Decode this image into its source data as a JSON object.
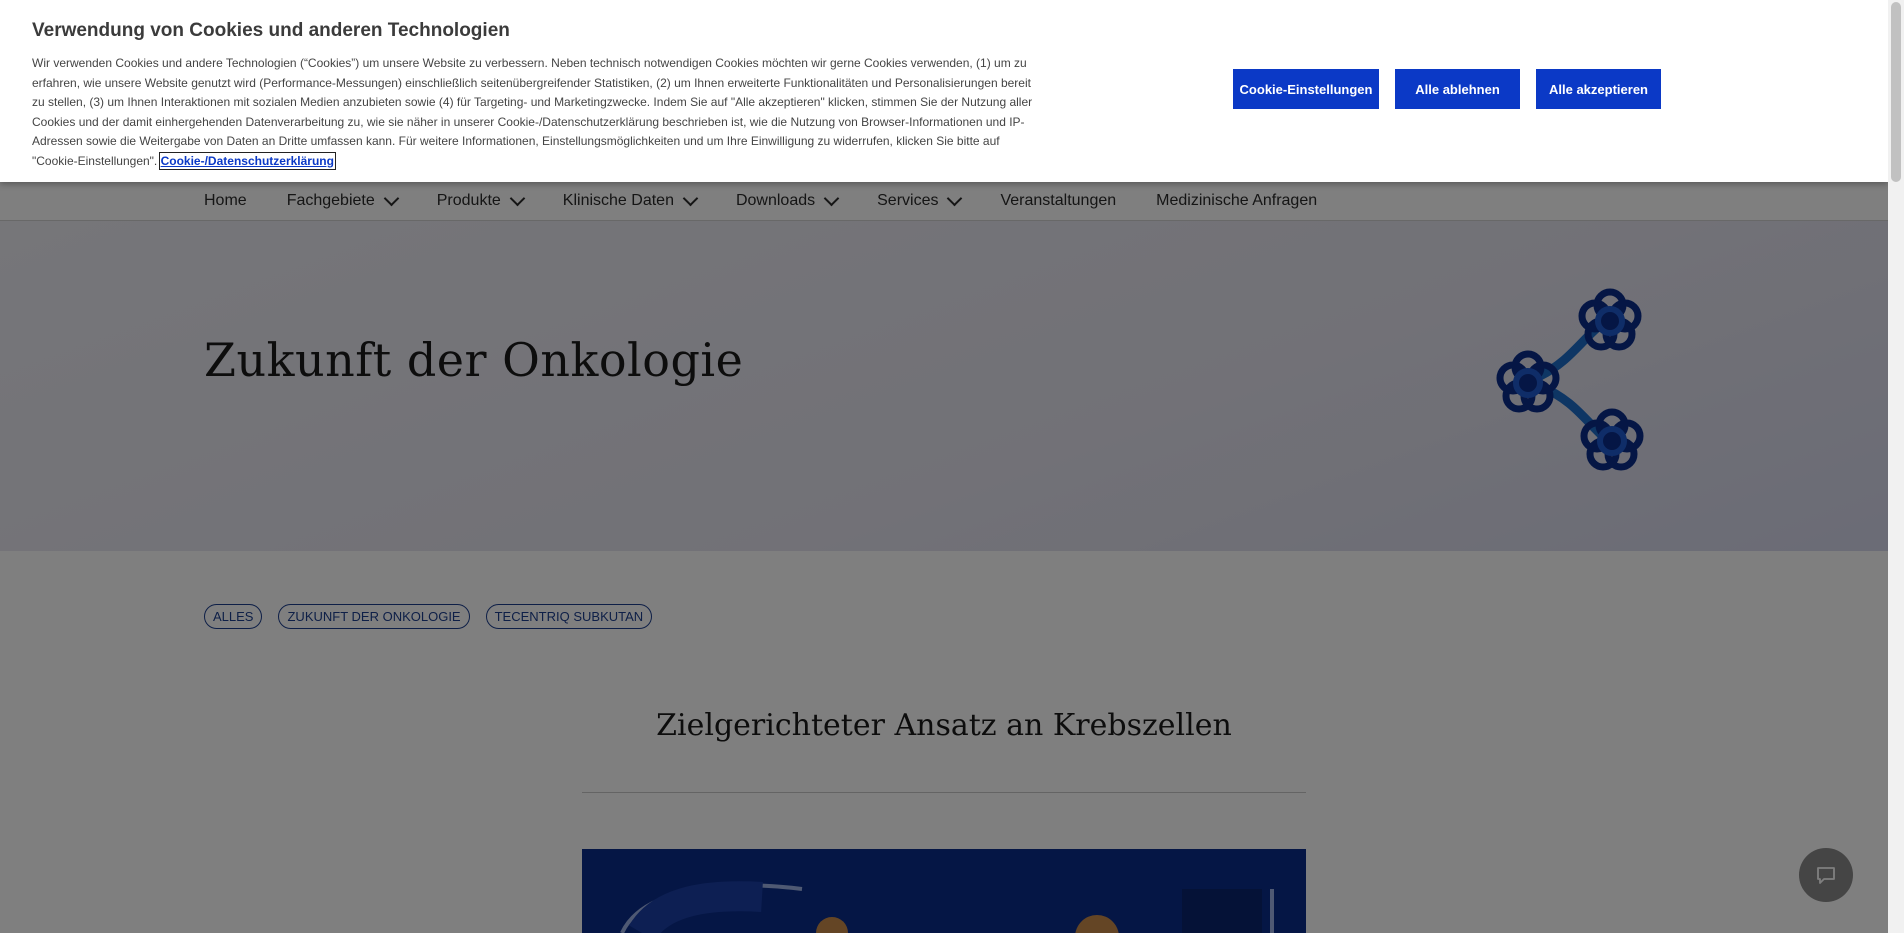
{
  "nav": {
    "items": [
      {
        "label": "Home",
        "has_dropdown": false
      },
      {
        "label": "Fachgebiete",
        "has_dropdown": true
      },
      {
        "label": "Produkte",
        "has_dropdown": true
      },
      {
        "label": "Klinische Daten",
        "has_dropdown": true
      },
      {
        "label": "Downloads",
        "has_dropdown": true
      },
      {
        "label": "Services",
        "has_dropdown": true
      },
      {
        "label": "Veranstaltungen",
        "has_dropdown": false
      },
      {
        "label": "Medizinische Anfragen",
        "has_dropdown": false
      }
    ]
  },
  "hero": {
    "title": "Zukunft der Onkologie",
    "icon": "cell-network-illustration"
  },
  "tags": [
    "ALLES",
    "ZUKUNFT DER ONKOLOGIE",
    "TECENTRIQ SUBKUTAN"
  ],
  "section": {
    "title": "Zielgerichteter Ansatz an Krebszellen"
  },
  "chat": {
    "icon": "chat-icon"
  },
  "cookie_banner": {
    "title": "Verwendung von Cookies und anderen Technologien",
    "text": "Wir verwenden Cookies und andere Technologien (“Cookies”) um unsere Website zu verbessern. Neben technisch notwendigen Cookies möchten wir gerne Cookies verwenden, (1) um zu erfahren, wie unsere Website genutzt wird (Performance-Messungen) einschließlich seitenübergreifender Statistiken, (2) um Ihnen erweiterte Funktionalitäten und Personalisierungen bereit zu stellen, (3) um Ihnen Interaktionen mit sozialen Medien anzubieten sowie (4) für Targeting- und Marketingzwecke. Indem Sie auf \"Alle akzeptieren\" klicken, stimmen Sie der Nutzung aller Cookies und der damit einhergehenden Datenverarbeitung zu, wie sie näher in unserer Cookie-/Datenschutzerklärung beschrieben ist, wie die Nutzung von Browser-Informationen und IP-Adressen sowie die Weitergabe von Daten an Dritte umfassen kann. Für weitere Informationen, Einstellungsmöglichkeiten und um Ihre Einwilligung zu widerrufen, klicken Sie bitte auf \"Cookie-Einstellungen\". ",
    "link_label": "Cookie-/Datenschutzerklärung",
    "settings_label": "Cookie-Einstellungen",
    "reject_label": "Alle ablehnen",
    "accept_label": "Alle akzeptieren",
    "accent_color": "#0b39c6"
  },
  "colors": {
    "brand_blue": "#0b39c6",
    "illustration_blue": "#0b2d8a",
    "tag_blue": "#1d3f8f"
  }
}
